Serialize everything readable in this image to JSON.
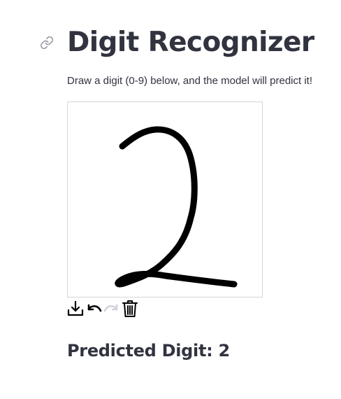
{
  "title": "Digit Recognizer",
  "subtitle": "Draw a digit (0-9) below, and the model will predict it!",
  "canvas": {
    "stroke_color": "#000000",
    "background": "#ffffff",
    "border_color": "#d6d6d6"
  },
  "toolbar": {
    "icons": [
      "download-icon",
      "undo-icon",
      "redo-icon",
      "trash-icon"
    ],
    "redo_enabled": false
  },
  "result": {
    "label": "Predicted Digit: 2"
  },
  "colors": {
    "text": "#31333f",
    "icon_muted": "#9a9ca3",
    "icon_disabled": "#d0d3da"
  }
}
